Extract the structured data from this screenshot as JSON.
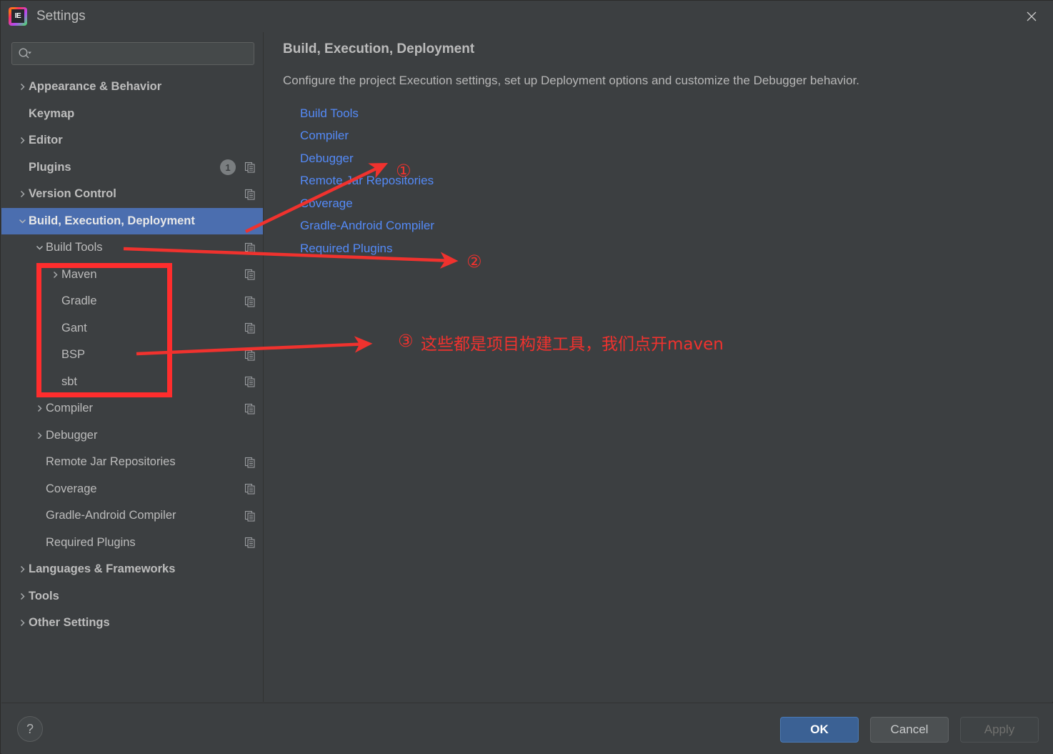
{
  "window": {
    "title": "Settings",
    "logo_icon": "intellij-idea-logo",
    "close_icon": "close-icon"
  },
  "search": {
    "value": "",
    "placeholder": "",
    "icon": "search-icon"
  },
  "sidebar": {
    "items": [
      {
        "label": "Appearance & Behavior",
        "level": 0,
        "chevron": "chevron-right",
        "bold": true,
        "selected": false,
        "badge": null,
        "copy_icon": false
      },
      {
        "label": "Keymap",
        "level": 0,
        "chevron": "none",
        "bold": true,
        "selected": false,
        "badge": null,
        "copy_icon": false
      },
      {
        "label": "Editor",
        "level": 0,
        "chevron": "chevron-right",
        "bold": true,
        "selected": false,
        "badge": null,
        "copy_icon": false
      },
      {
        "label": "Plugins",
        "level": 0,
        "chevron": "none",
        "bold": true,
        "selected": false,
        "badge": "1",
        "copy_icon": true
      },
      {
        "label": "Version Control",
        "level": 0,
        "chevron": "chevron-right",
        "bold": true,
        "selected": false,
        "badge": null,
        "copy_icon": true
      },
      {
        "label": "Build, Execution, Deployment",
        "level": 0,
        "chevron": "chevron-down",
        "bold": true,
        "selected": true,
        "badge": null,
        "copy_icon": false
      },
      {
        "label": "Build Tools",
        "level": 1,
        "chevron": "chevron-down",
        "bold": false,
        "selected": false,
        "badge": null,
        "copy_icon": true
      },
      {
        "label": "Maven",
        "level": 2,
        "chevron": "chevron-right",
        "bold": false,
        "selected": false,
        "badge": null,
        "copy_icon": true
      },
      {
        "label": "Gradle",
        "level": 2,
        "chevron": "none",
        "bold": false,
        "selected": false,
        "badge": null,
        "copy_icon": true
      },
      {
        "label": "Gant",
        "level": 2,
        "chevron": "none",
        "bold": false,
        "selected": false,
        "badge": null,
        "copy_icon": true
      },
      {
        "label": "BSP",
        "level": 2,
        "chevron": "none",
        "bold": false,
        "selected": false,
        "badge": null,
        "copy_icon": true
      },
      {
        "label": "sbt",
        "level": 2,
        "chevron": "none",
        "bold": false,
        "selected": false,
        "badge": null,
        "copy_icon": true
      },
      {
        "label": "Compiler",
        "level": 1,
        "chevron": "chevron-right",
        "bold": false,
        "selected": false,
        "badge": null,
        "copy_icon": true
      },
      {
        "label": "Debugger",
        "level": 1,
        "chevron": "chevron-right",
        "bold": false,
        "selected": false,
        "badge": null,
        "copy_icon": false
      },
      {
        "label": "Remote Jar Repositories",
        "level": 1,
        "chevron": "none",
        "bold": false,
        "selected": false,
        "badge": null,
        "copy_icon": true
      },
      {
        "label": "Coverage",
        "level": 1,
        "chevron": "none",
        "bold": false,
        "selected": false,
        "badge": null,
        "copy_icon": true
      },
      {
        "label": "Gradle-Android Compiler",
        "level": 1,
        "chevron": "none",
        "bold": false,
        "selected": false,
        "badge": null,
        "copy_icon": true
      },
      {
        "label": "Required Plugins",
        "level": 1,
        "chevron": "none",
        "bold": false,
        "selected": false,
        "badge": null,
        "copy_icon": true
      },
      {
        "label": "Languages & Frameworks",
        "level": 0,
        "chevron": "chevron-right",
        "bold": true,
        "selected": false,
        "badge": null,
        "copy_icon": false
      },
      {
        "label": "Tools",
        "level": 0,
        "chevron": "chevron-right",
        "bold": true,
        "selected": false,
        "badge": null,
        "copy_icon": false
      },
      {
        "label": "Other Settings",
        "level": 0,
        "chevron": "chevron-right",
        "bold": true,
        "selected": false,
        "badge": null,
        "copy_icon": false
      }
    ]
  },
  "main": {
    "title": "Build, Execution, Deployment",
    "description": "Configure the project Execution settings, set up Deployment options and customize the Debugger behavior.",
    "links": [
      {
        "label": "Build Tools"
      },
      {
        "label": "Compiler"
      },
      {
        "label": "Debugger"
      },
      {
        "label": "Remote Jar Repositories"
      },
      {
        "label": "Coverage"
      },
      {
        "label": "Gradle-Android Compiler"
      },
      {
        "label": "Required Plugins"
      }
    ]
  },
  "footer": {
    "help_label": "?",
    "ok_label": "OK",
    "cancel_label": "Cancel",
    "apply_label": "Apply"
  },
  "annotations": {
    "color": "#f0322e",
    "marker_1": "①",
    "marker_2": "②",
    "marker_3": "③",
    "note_3": "这些都是项目构建工具，我们点开maven"
  },
  "colors": {
    "background": "#3c3f41",
    "selection": "#4b6eaf",
    "link": "#548af7",
    "text": "#bbbbbb",
    "annotation_red": "#f0322e",
    "primary_button": "#3b6194"
  }
}
